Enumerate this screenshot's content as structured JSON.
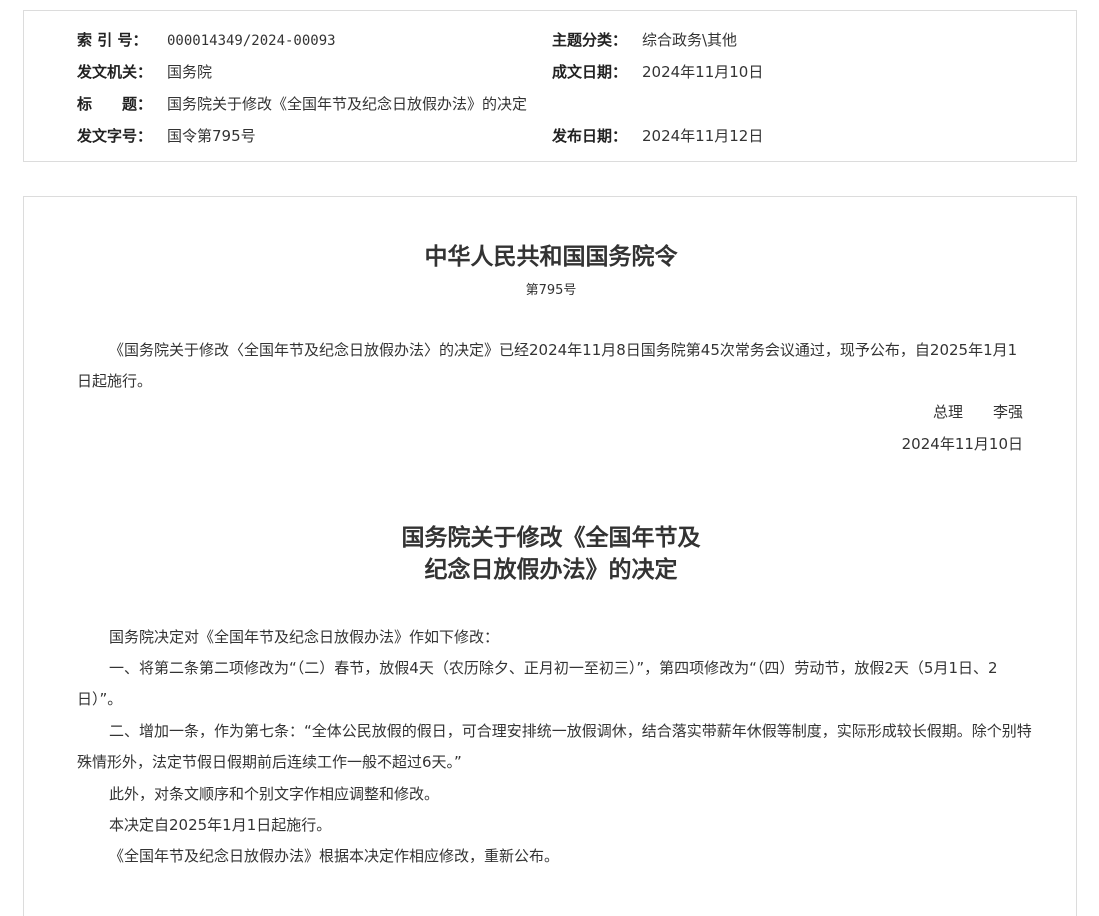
{
  "meta": {
    "index_label": "索 引 号：",
    "index_value": "000014349/2024-00093",
    "category_label": "主题分类：",
    "category_value": "综合政务\\其他",
    "issuer_label": "发文机关：",
    "issuer_value": "国务院",
    "created_label": "成文日期：",
    "created_value": "2024年11月10日",
    "title_label": "标　　题：",
    "title_value": "国务院关于修改《全国年节及纪念日放假办法》的决定",
    "docno_label": "发文字号：",
    "docno_value": "国令第795号",
    "published_label": "发布日期：",
    "published_value": "2024年11月12日"
  },
  "order": {
    "title": "中华人民共和国国务院令",
    "number": "第795号",
    "body": "《国务院关于修改〈全国年节及纪念日放假办法〉的决定》已经2024年11月8日国务院第45次常务会议通过，现予公布，自2025年1月1日起施行。",
    "signer": "总理　　李强",
    "date": "2024年11月10日"
  },
  "decision": {
    "title_line1": "国务院关于修改《全国年节及",
    "title_line2": "纪念日放假办法》的决定",
    "paragraphs": [
      "国务院决定对《全国年节及纪念日放假办法》作如下修改：",
      "一、将第二条第二项修改为“（二）春节，放假4天（农历除夕、正月初一至初三）”，第四项修改为“（四）劳动节，放假2天（5月1日、2日）”。",
      "二、增加一条，作为第七条：“全体公民放假的假日，可合理安排统一放假调休，结合落实带薪年休假等制度，实际形成较长假期。除个别特殊情形外，法定节假日假期前后连续工作一般不超过6天。”",
      "此外，对条文顺序和个别文字作相应调整和修改。",
      "本决定自2025年1月1日起施行。",
      "《全国年节及纪念日放假办法》根据本决定作相应修改，重新公布。"
    ]
  }
}
